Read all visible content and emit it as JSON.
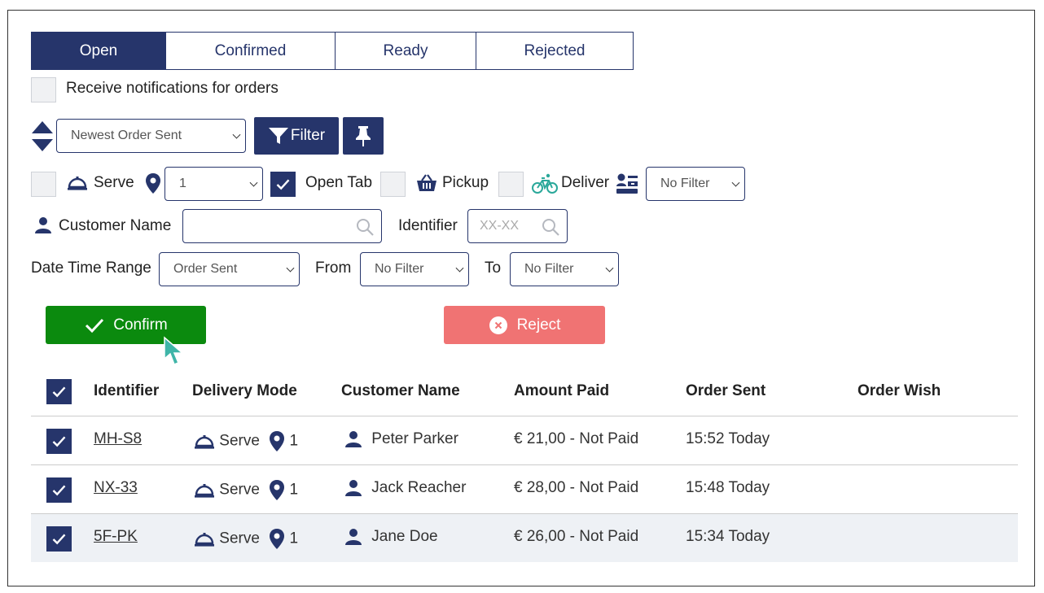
{
  "tabs": [
    {
      "label": "Open",
      "active": true
    },
    {
      "label": "Confirmed",
      "active": false
    },
    {
      "label": "Ready",
      "active": false
    },
    {
      "label": "Rejected",
      "active": false
    }
  ],
  "notifications_label": "Receive notifications for orders",
  "sort": {
    "value": "Newest Order Sent"
  },
  "filter_button_label": "Filter",
  "modes": {
    "serve_label": "Serve",
    "table_value": "1",
    "open_tab_label": "Open Tab",
    "pickup_label": "Pickup",
    "deliver_label": "Deliver",
    "courier_filter_value": "No Filter"
  },
  "search": {
    "customer_name_label": "Customer Name",
    "customer_name_value": "",
    "identifier_label": "Identifier",
    "identifier_placeholder": "XX-XX"
  },
  "date_range": {
    "label": "Date Time Range",
    "type_value": "Order Sent",
    "from_label": "From",
    "from_value": "No Filter",
    "to_label": "To",
    "to_value": "No Filter"
  },
  "actions": {
    "confirm_label": "Confirm",
    "reject_label": "Reject"
  },
  "table": {
    "headers": {
      "identifier": "Identifier",
      "delivery_mode": "Delivery Mode",
      "customer_name": "Customer Name",
      "amount_paid": "Amount Paid",
      "order_sent": "Order Sent",
      "order_wish": "Order Wish"
    },
    "rows": [
      {
        "identifier": "MH-S8",
        "mode": "Serve",
        "table": "1",
        "customer": "Peter Parker",
        "amount": "€ 21,00 - Not Paid",
        "sent": "15:52 Today",
        "wish": ""
      },
      {
        "identifier": "NX-33",
        "mode": "Serve",
        "table": "1",
        "customer": "Jack Reacher",
        "amount": "€ 28,00 - Not Paid",
        "sent": "15:48 Today",
        "wish": ""
      },
      {
        "identifier": "5F-PK",
        "mode": "Serve",
        "table": "1",
        "customer": "Jane Doe",
        "amount": "€ 26,00 - Not Paid",
        "sent": "15:34 Today",
        "wish": ""
      }
    ]
  },
  "colors": {
    "navy": "#26356b",
    "confirm": "#0b8a0e",
    "reject": "#f07373",
    "row_highlight": "#eef1f5",
    "cursor": "#3fb5a8"
  }
}
